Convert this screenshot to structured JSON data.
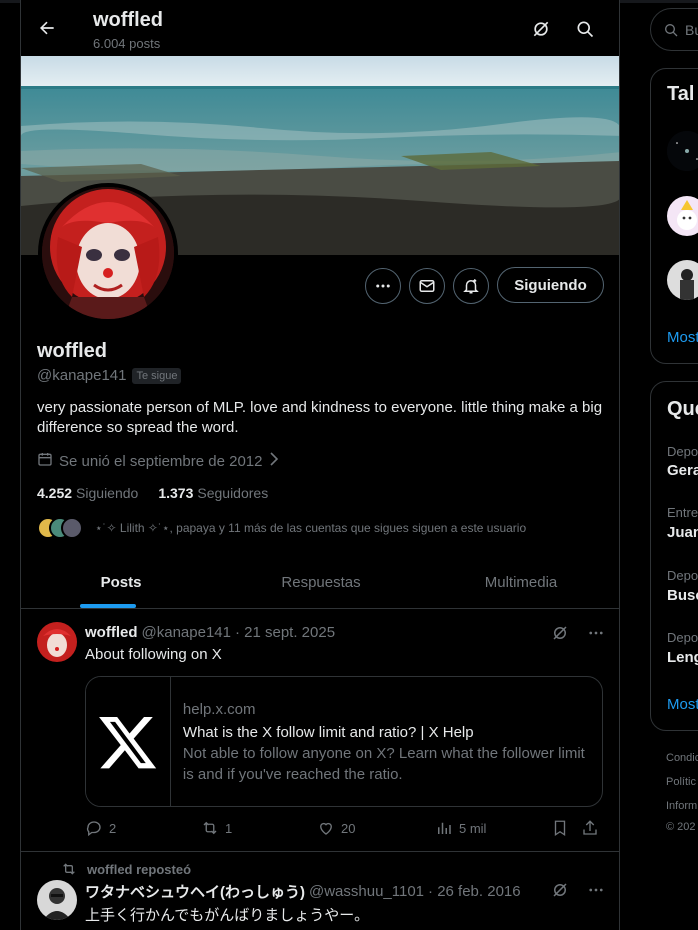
{
  "header": {
    "title": "woffled",
    "subtitle": "6.004 posts"
  },
  "profile": {
    "name": "woffled",
    "handle": "@kanape141",
    "follows_you": "Te sigue",
    "bio": "very passionate person of MLP. love and kindness to everyone. little thing make a big difference so spread the word.",
    "joined": "Se unió el septiembre de 2012",
    "following_count": "4.252",
    "following_label": "Siguiendo",
    "followers_count": "1.373",
    "followers_label": "Seguidores",
    "followers_you_know": "⋆˙✧ Lilith ✧˙⋆, papaya y 11 más de las cuentas que sigues siguen a este usuario",
    "follow_button": "Siguiendo"
  },
  "tabs": [
    {
      "label": "Posts",
      "active": true
    },
    {
      "label": "Respuestas",
      "active": false
    },
    {
      "label": "Multimedia",
      "active": false
    }
  ],
  "posts": [
    {
      "name": "woffled",
      "handle": "@kanape141",
      "date": "· 21 sept. 2025",
      "text": "About following on X",
      "card": {
        "domain": "help.x.com",
        "title": "What is the X follow limit and ratio? | X Help",
        "description": "Not able to follow anyone on X? Learn what the follower limit is and if you've reached the ratio."
      },
      "replies": "2",
      "reposts": "1",
      "likes": "20",
      "views": "5 mil"
    },
    {
      "repost_label": "woffled reposteó",
      "name": "ワタナベシュウヘイ(わっしゅう)",
      "handle": "@wasshuu_1101",
      "date": "· 26 feb. 2016",
      "text": "上手く行かんでもがんばりましょうやー。"
    }
  ],
  "sidebar": {
    "search_placeholder": "Bu",
    "panel1_title": "Tal",
    "panel1_more": "Most",
    "panel2_title": "Qué",
    "trends": [
      {
        "category": "Depo",
        "name": "Gera"
      },
      {
        "category": "Entre",
        "name": "Juan"
      },
      {
        "category": "Depo",
        "name": "Busc"
      },
      {
        "category": "Depo",
        "name": "Leng"
      }
    ],
    "panel2_more": "Most",
    "footer": [
      "Condic",
      "Polític",
      "Inform",
      "© 202"
    ]
  },
  "colors": {
    "accent": "#1d9bf0",
    "border": "#2f3336",
    "muted": "#71767b"
  }
}
